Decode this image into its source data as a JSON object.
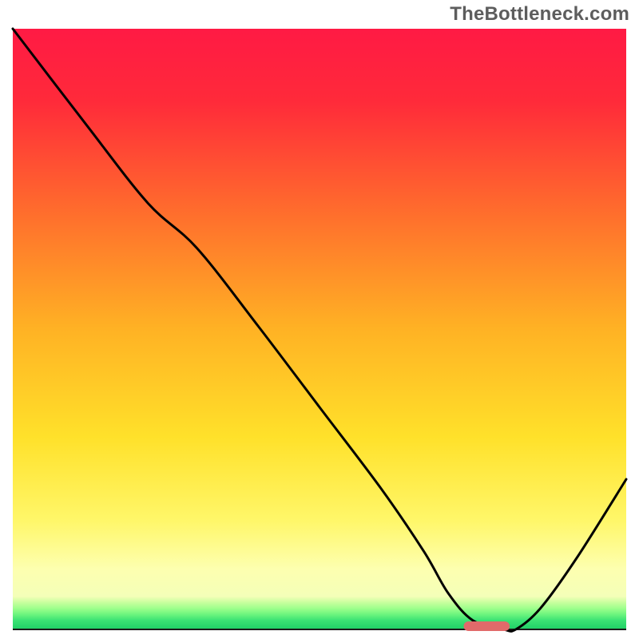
{
  "watermark": "TheBottleneck.com",
  "chart_data": {
    "type": "line",
    "title": "",
    "xlabel": "",
    "ylabel": "",
    "xlim": [
      0,
      100
    ],
    "ylim": [
      0,
      100
    ],
    "gradient_stops": [
      {
        "offset": 0.0,
        "color": "#ff1a44"
      },
      {
        "offset": 0.12,
        "color": "#ff2a3a"
      },
      {
        "offset": 0.3,
        "color": "#ff6b2d"
      },
      {
        "offset": 0.5,
        "color": "#ffb224"
      },
      {
        "offset": 0.68,
        "color": "#ffe12a"
      },
      {
        "offset": 0.82,
        "color": "#fff76a"
      },
      {
        "offset": 0.9,
        "color": "#fdffb0"
      },
      {
        "offset": 0.945,
        "color": "#f4ffb8"
      },
      {
        "offset": 0.955,
        "color": "#c8ff9e"
      },
      {
        "offset": 0.965,
        "color": "#9dff8c"
      },
      {
        "offset": 0.975,
        "color": "#6cf57e"
      },
      {
        "offset": 0.985,
        "color": "#3be274"
      },
      {
        "offset": 1.0,
        "color": "#1fcf66"
      }
    ],
    "x": [
      0.0,
      12.0,
      22.0,
      30.0,
      40.0,
      50.0,
      60.0,
      67.0,
      71.0,
      75.0,
      80.0,
      82.0,
      86.0,
      92.0,
      100.0
    ],
    "values": [
      100.0,
      84.0,
      71.0,
      63.5,
      50.5,
      37.0,
      23.5,
      13.0,
      6.0,
      1.5,
      0.0,
      0.0,
      3.5,
      12.0,
      25.0
    ],
    "marker": {
      "x_start": 73.5,
      "x_end": 81.0,
      "color": "#e16a6a"
    }
  }
}
